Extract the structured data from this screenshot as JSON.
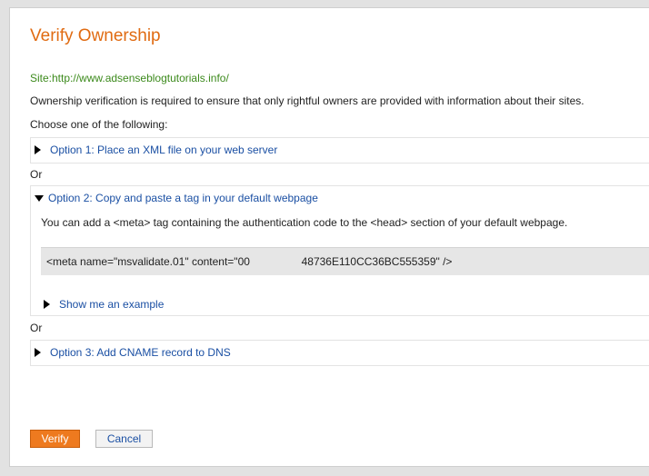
{
  "page": {
    "title": "Verify Ownership",
    "site": "Site:http://www.adsenseblogtutorials.info/",
    "description": "Ownership verification is required to ensure that only rightful owners are provided with information about their sites.",
    "choose_label": "Choose one of the following:",
    "or_label": "Or"
  },
  "options": [
    {
      "label": "Option 1: Place an XML file on your web server",
      "expanded": false
    },
    {
      "label": "Option 2: Copy and paste a tag in your default webpage",
      "expanded": true,
      "instruction": "You can add a <meta> tag containing the authentication code to the <head> section of your default webpage.",
      "meta_tag": "<meta name=\"msvalidate.01\" content=\"00                 48736E110CC36BC555359\" />",
      "show_example_label": "Show me an example"
    },
    {
      "label": "Option 3: Add CNAME record to DNS",
      "expanded": false
    }
  ],
  "buttons": {
    "verify": "Verify",
    "cancel": "Cancel"
  },
  "colors": {
    "title": "#e06b12",
    "site": "#3c8a1c",
    "link": "#1a4fa3",
    "verify_button": "#ee7a1f"
  },
  "icons": {
    "collapsed": "triangle-right-icon",
    "expanded": "triangle-down-icon"
  }
}
